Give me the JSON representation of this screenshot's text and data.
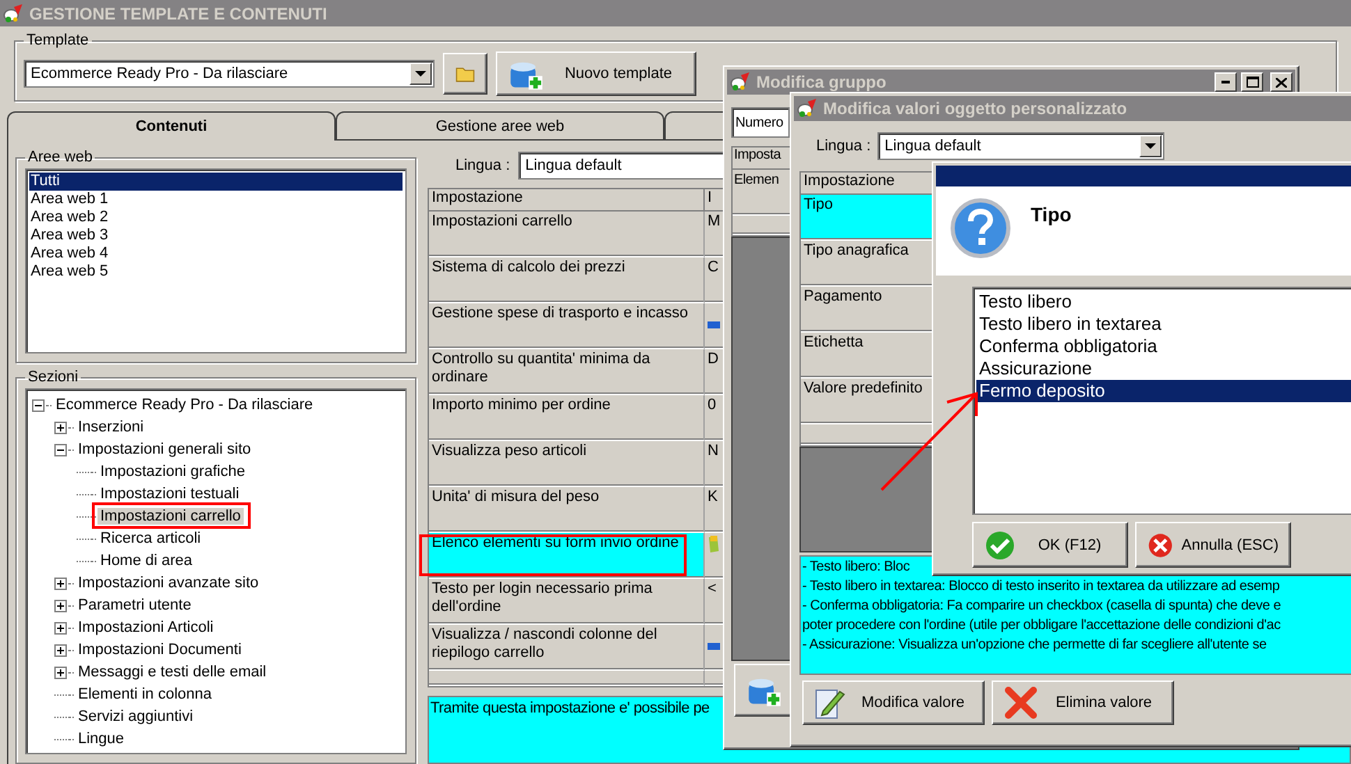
{
  "window": {
    "title": "GESTIONE TEMPLATE E CONTENUTI"
  },
  "template": {
    "label": "Template",
    "value": "Ecommerce Ready Pro - Da rilasciare",
    "new_button": "Nuovo template"
  },
  "tabs": [
    {
      "label": "Contenuti",
      "selected": true
    },
    {
      "label": "Gestione aree web",
      "selected": false
    }
  ],
  "web_areas": {
    "title": "Aree web",
    "items": [
      {
        "label": "Tutti",
        "selected": true
      },
      {
        "label": "Area web 1",
        "selected": false
      },
      {
        "label": "Area web 2",
        "selected": false
      },
      {
        "label": "Area web 3",
        "selected": false
      },
      {
        "label": "Area web 4",
        "selected": false
      },
      {
        "label": "Area web 5",
        "selected": false
      }
    ]
  },
  "sections": {
    "title": "Sezioni",
    "tree": [
      {
        "label": "Ecommerce Ready Pro - Da rilasciare",
        "expanded": true,
        "selected": false,
        "children": [
          {
            "label": "Inserzioni",
            "expanded": false,
            "selected": false
          },
          {
            "label": "Impostazioni generali sito",
            "expanded": true,
            "selected": false,
            "children": [
              {
                "label": "Impostazioni grafiche",
                "selected": false
              },
              {
                "label": "Impostazioni testuali",
                "selected": false
              },
              {
                "label": "Impostazioni carrello",
                "selected": true
              },
              {
                "label": "Ricerca articoli",
                "selected": false
              },
              {
                "label": "Home di area",
                "selected": false
              }
            ]
          },
          {
            "label": "Impostazioni avanzate sito",
            "expanded": false,
            "selected": false
          },
          {
            "label": "Parametri utente",
            "expanded": false,
            "selected": false
          },
          {
            "label": "Impostazioni Articoli",
            "expanded": false,
            "selected": false
          },
          {
            "label": "Impostazioni Documenti",
            "expanded": false,
            "selected": false
          },
          {
            "label": "Messaggi e testi delle email",
            "expanded": false,
            "selected": false
          },
          {
            "label": "Elementi in colonna",
            "selected": false
          },
          {
            "label": "Servizi aggiuntivi",
            "selected": false
          },
          {
            "label": "Lingue",
            "selected": false
          }
        ]
      }
    ]
  },
  "settings": {
    "language_label": "Lingua :",
    "language": "Lingua default",
    "columns": [
      "Impostazione",
      "I"
    ],
    "rows": [
      {
        "name": "Impostazioni carrello",
        "kind": "text",
        "value": "M",
        "selected": false
      },
      {
        "name": "Sistema di calcolo dei prezzi",
        "kind": "text",
        "value": "C",
        "selected": false
      },
      {
        "name": "Gestione spese di trasporto e incasso",
        "kind": "bar",
        "selected": false
      },
      {
        "name": "Controllo su quantita' minima da ordinare",
        "kind": "text",
        "value": "D",
        "selected": false
      },
      {
        "name": "Importo minimo per ordine",
        "kind": "text",
        "value": "0",
        "selected": false
      },
      {
        "name": "Visualizza peso articoli",
        "kind": "text",
        "value": "N",
        "selected": false
      },
      {
        "name": "Unita' di misura del peso",
        "kind": "text",
        "value": "K",
        "selected": false
      },
      {
        "name": "Elenco elementi su form invio ordine",
        "kind": "edit",
        "selected": true
      },
      {
        "name": "Testo per login necessario prima dell'ordine",
        "kind": "text",
        "value": "<",
        "selected": false
      },
      {
        "name": "Visualizza / nascondi colonne del riepilogo carrello",
        "kind": "bar",
        "selected": false
      }
    ],
    "description": "Tramite questa impostazione e' possibile pe"
  },
  "group_dialog": {
    "title": "Modifica gruppo",
    "number_label": "Numero",
    "column": "Imposta",
    "rows": [
      "Elemen"
    ]
  },
  "values_dialog": {
    "title": "Modifica valori oggetto personalizzato",
    "language_label": "Lingua :",
    "language": "Lingua default",
    "column": "Impostazione",
    "rows": [
      {
        "name": "Tipo",
        "selected": true
      },
      {
        "name": "Tipo anagrafica",
        "selected": false
      },
      {
        "name": "Pagamento",
        "selected": false
      },
      {
        "name": "Etichetta",
        "selected": false
      },
      {
        "name": "Valore predefinito",
        "selected": false
      }
    ],
    "description": [
      "- Testo libero: Bloc",
      "- Testo libero in textarea: Blocco di testo inserito in textarea da utilizzare ad esemp",
      "- Conferma obbligatoria: Fa comparire un checkbox (casella di spunta) che deve e",
      "poter procedere con l'ordine (utile per obbligare l'accettazione delle condizioni d'ac",
      "- Assicurazione: Visualizza un'opzione che permette di far scegliere all'utente se"
    ],
    "buttons": [
      "Modifica valore",
      "Elimina valore"
    ]
  },
  "type_dialog": {
    "heading": "Tipo",
    "options": [
      {
        "label": "Testo libero",
        "selected": false
      },
      {
        "label": "Testo libero in textarea",
        "selected": false
      },
      {
        "label": "Conferma obbligatoria",
        "selected": false
      },
      {
        "label": "Assicurazione",
        "selected": false
      },
      {
        "label": "Fermo deposito",
        "selected": true
      }
    ],
    "ok": "OK (F12)",
    "cancel": "Annulla (ESC)"
  }
}
